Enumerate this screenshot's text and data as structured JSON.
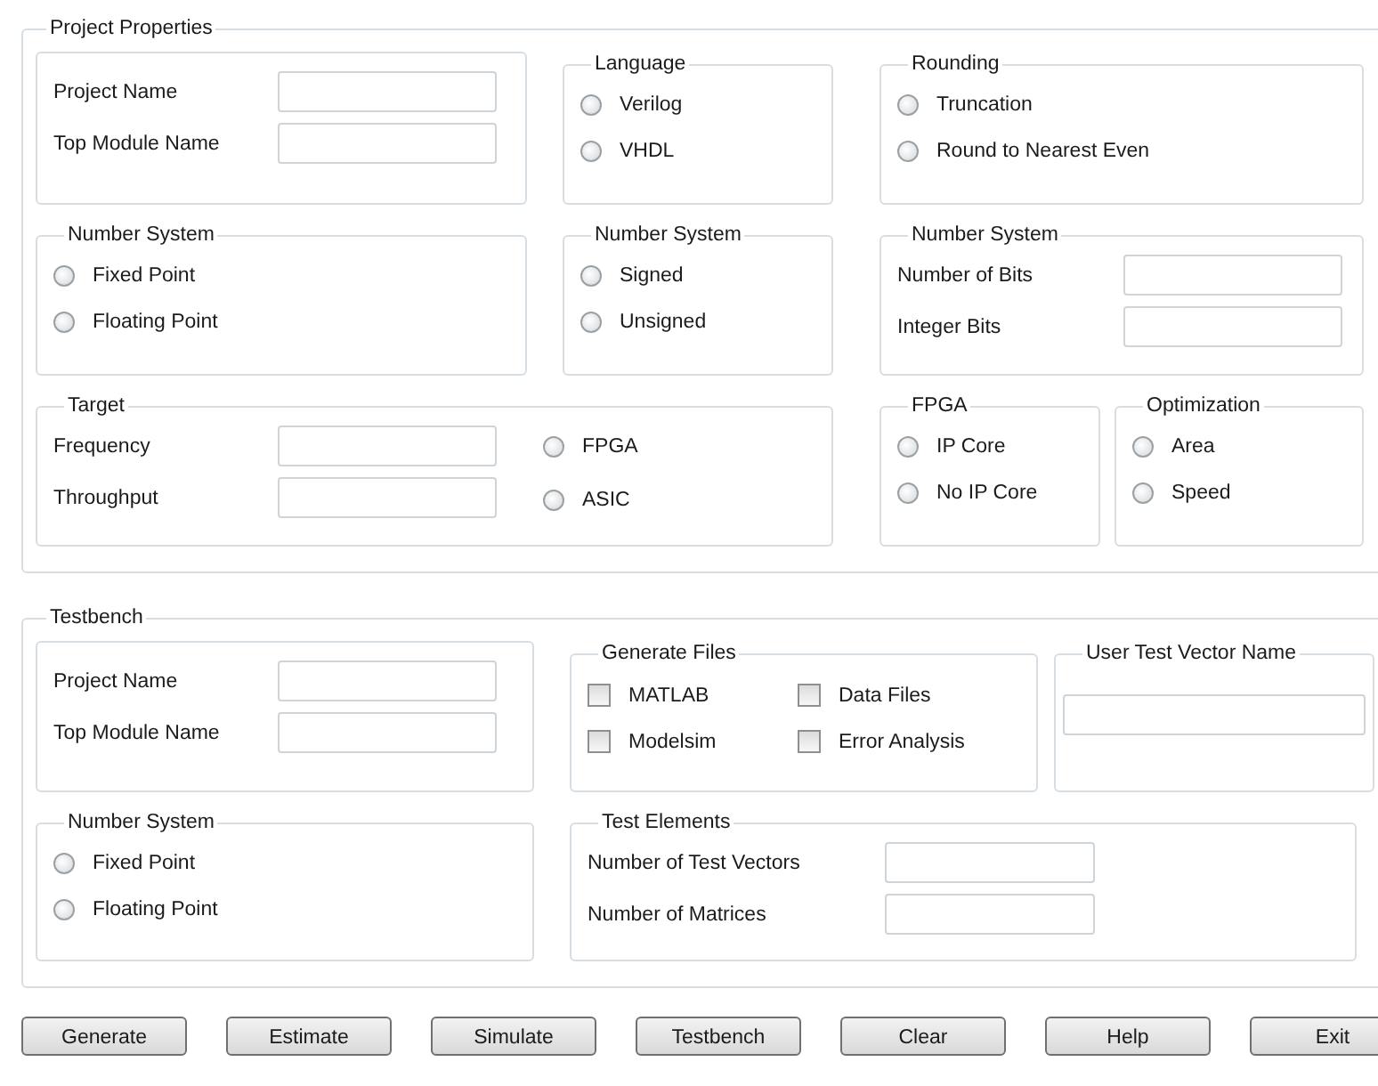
{
  "project_properties": {
    "title": "Project Properties",
    "identity": {
      "fields": [
        {
          "label": "Project Name"
        },
        {
          "label": "Top Module Name"
        }
      ]
    },
    "language": {
      "title": "Language",
      "options": [
        {
          "label": "Verilog",
          "selected": false
        },
        {
          "label": "VHDL",
          "selected": false
        }
      ]
    },
    "rounding": {
      "title": "Rounding",
      "options": [
        {
          "label": "Truncation",
          "selected": false
        },
        {
          "label": "Round to Nearest Even",
          "selected": false
        }
      ]
    },
    "number_system": {
      "title": "Number System",
      "options": [
        {
          "label": "Fixed Point",
          "selected": false
        },
        {
          "label": "Floating Point",
          "selected": false
        }
      ]
    },
    "signedness": {
      "title": "Number System",
      "options": [
        {
          "label": "Signed",
          "selected": false
        },
        {
          "label": "Unsigned",
          "selected": false
        }
      ]
    },
    "bit_widths": {
      "title": "Number System",
      "fields": [
        {
          "label": "Number of Bits"
        },
        {
          "label": "Integer Bits"
        }
      ]
    },
    "target": {
      "title": "Target",
      "fields": [
        {
          "label": "Frequency"
        },
        {
          "label": "Throughput"
        }
      ],
      "options": [
        {
          "label": "FPGA",
          "selected": false
        },
        {
          "label": "ASIC",
          "selected": false
        }
      ]
    },
    "fpga": {
      "title": "FPGA",
      "options": [
        {
          "label": "IP Core",
          "selected": false
        },
        {
          "label": "No IP Core",
          "selected": false
        }
      ]
    },
    "optimization": {
      "title": "Optimization",
      "options": [
        {
          "label": "Area",
          "selected": false
        },
        {
          "label": "Speed",
          "selected": false
        }
      ]
    }
  },
  "testbench": {
    "title": "Testbench",
    "identity": {
      "fields": [
        {
          "label": "Project Name"
        },
        {
          "label": "Top Module Name"
        }
      ]
    },
    "generate_files": {
      "title": "Generate Files",
      "checkboxes": [
        {
          "label": "MATLAB",
          "checked": false
        },
        {
          "label": "Data Files",
          "checked": false
        },
        {
          "label": "Modelsim",
          "checked": false
        },
        {
          "label": "Error Analysis",
          "checked": false
        }
      ]
    },
    "user_test_vector_name": {
      "title": "User Test Vector Name"
    },
    "number_system": {
      "title": "Number System",
      "options": [
        {
          "label": "Fixed Point",
          "selected": false
        },
        {
          "label": "Floating Point",
          "selected": false
        }
      ]
    },
    "test_elements": {
      "title": "Test Elements",
      "fields": [
        {
          "label": "Number of Test Vectors"
        },
        {
          "label": "Number of Matrices"
        }
      ]
    }
  },
  "buttons": [
    "Generate",
    "Estimate",
    "Simulate",
    "Testbench",
    "Clear",
    "Help",
    "Exit"
  ]
}
